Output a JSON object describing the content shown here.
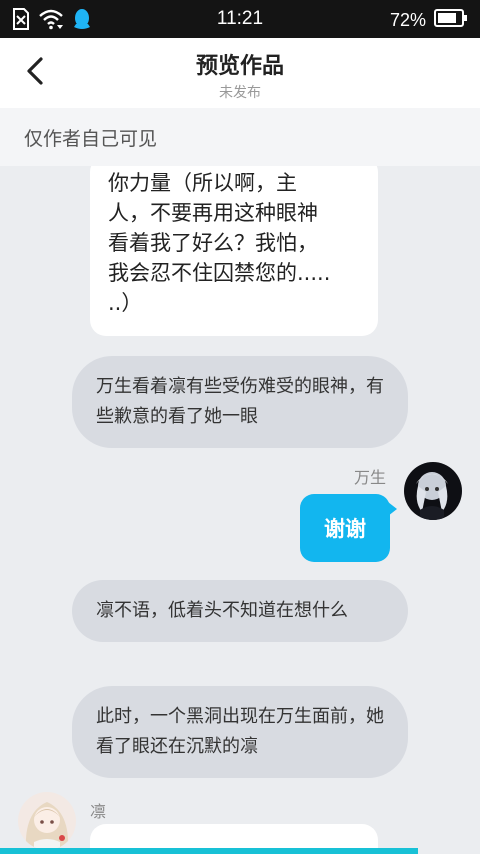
{
  "status_bar": {
    "time": "11:21",
    "battery_percent": "72%",
    "icons": [
      "sim-error-icon",
      "wifi-icon",
      "qq-penguin-icon",
      "battery-icon"
    ]
  },
  "header": {
    "back_icon": "chevron-left-icon",
    "title": "预览作品",
    "subtitle": "未发布"
  },
  "notice": {
    "text": "仅作者自己可见"
  },
  "messages": {
    "partial_bubble": "你力量（所以啊，主\n人，不要再用这种眼神\n看着我了好么？我怕，\n我会忍不住囚禁您的.....\n..）",
    "narration_1": "万生看着凛有些受伤难受的眼神，有些歉意的看了她一眼",
    "wansheng_name": "万生",
    "wansheng_message": "谢谢",
    "narration_2": "凛不语，低着头不知道在想什么",
    "narration_3": "此时，一个黑洞出现在万生面前，她看了眼还在沉默的凛",
    "lin_name": "凛"
  },
  "colors": {
    "accent_blue": "#12b6ef",
    "narration_bg": "#d8dbe1",
    "chat_bg": "#ebedf0",
    "bottom_bar": "#18c1d6"
  }
}
